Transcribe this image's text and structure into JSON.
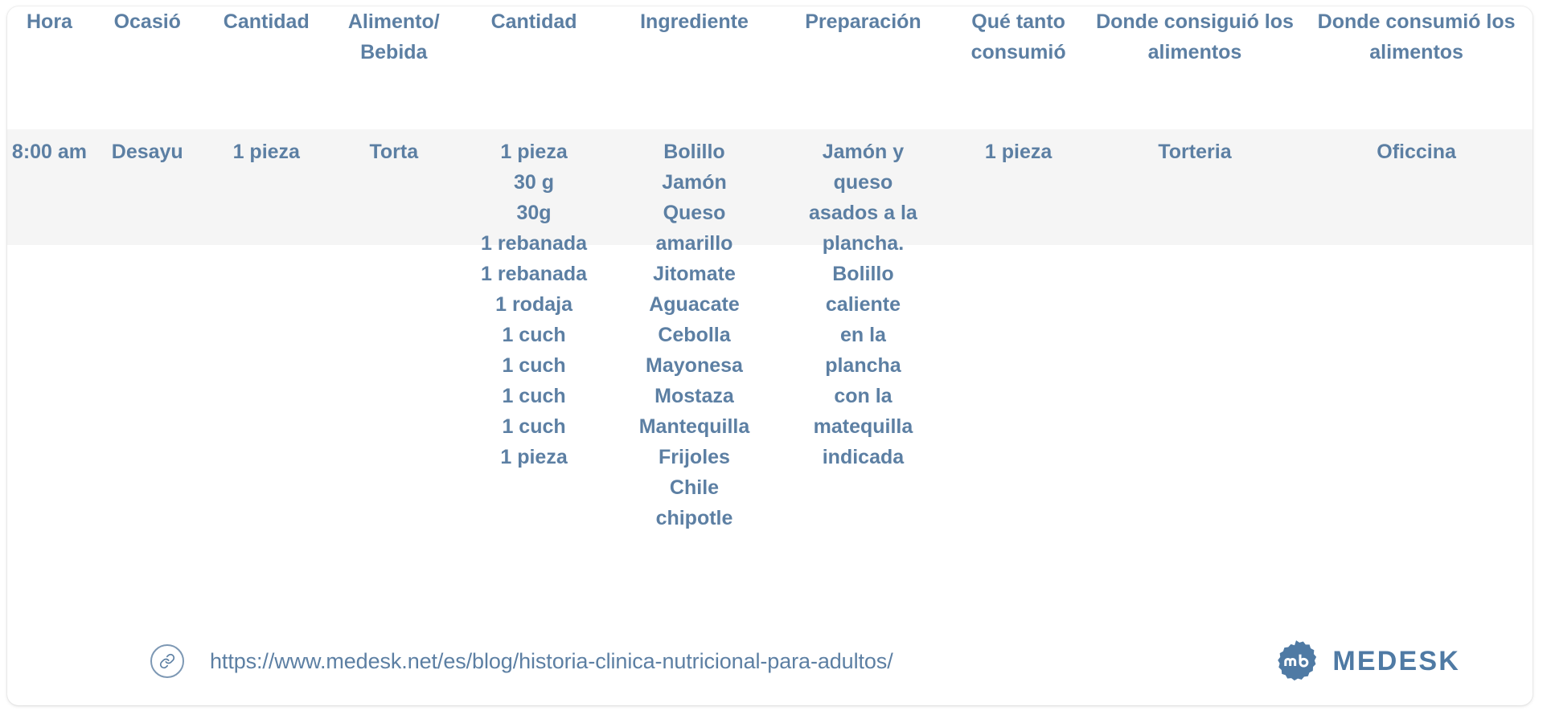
{
  "card": {
    "accent_color": "#5c7fa3",
    "row_highlight_color": "#f5f5f5",
    "brand_color": "#4f7aa4"
  },
  "table": {
    "headers": [
      "Hora",
      "Ocasió",
      "Cantidad",
      "Alimento/ Bebida",
      "Cantidad",
      "Ingrediente",
      "Preparación",
      "Qué tanto consumió",
      "Donde consiguió los alimentos",
      "Donde consumió los alimentos"
    ],
    "rows": [
      {
        "hora": "8:00 am",
        "ocasion": "Desayu",
        "cantidad_1": "1 pieza",
        "alimento_bebida": "Torta",
        "cantidad_2": [
          "1 pieza",
          "30 g",
          "30g",
          "1 rebanada",
          "1 rebanada",
          "1 rodaja",
          "1 cuch",
          "1 cuch",
          "1 cuch",
          "1 cuch",
          "1 pieza"
        ],
        "ingrediente": [
          "Bolillo",
          "Jamón",
          "Queso",
          "amarillo",
          "Jitomate",
          "Aguacate",
          "Cebolla",
          "Mayonesa",
          "Mostaza",
          "Mantequilla",
          "Frijoles",
          "Chile",
          "chipotle"
        ],
        "preparacion": [
          "Jamón y",
          "queso",
          "asados a la",
          "plancha.",
          "Bolillo",
          "caliente",
          "en la",
          "plancha",
          "con la",
          "matequilla",
          "indicada"
        ],
        "que_tanto_consumio": "1 pieza",
        "donde_consiguio": "Torteria",
        "donde_consumio": "Oficcina"
      }
    ]
  },
  "footer": {
    "link_icon": "link-icon",
    "url": "https://www.medesk.net/es/blog/historia-clinica-nutricional-para-adultos/",
    "brand_icon": "medesk-logo-icon",
    "brand_name": "MEDESK"
  }
}
